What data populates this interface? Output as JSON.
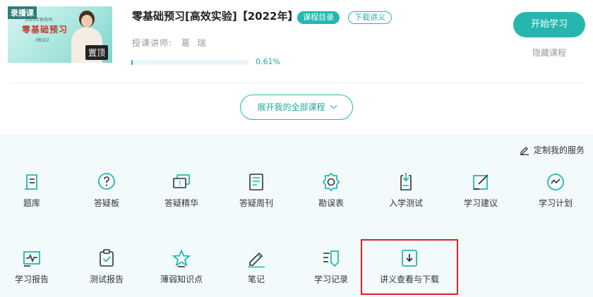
{
  "course": {
    "thumb_tag": "录播课",
    "thumb_year": "2022年税务师",
    "thumb_title": "零基础预习",
    "thumb_sub": "《税法Ⅰ》",
    "pin_label": "置顶",
    "title": "零基础预习[高效实验]【2022年】",
    "badge_catalog": "课程目录",
    "badge_download": "下载讲义",
    "teacher_label": "授课讲师:",
    "teacher_name": "葛  瑞",
    "progress_percent": 0.61,
    "progress_text": "0.61%",
    "start_button": "开始学习",
    "hide_link": "隐藏课程"
  },
  "expand_button": "展开我的全部课程",
  "service": {
    "custom_label": "定制我的服务",
    "tools": [
      {
        "label": "题库",
        "icon": "question-bank-icon"
      },
      {
        "label": "答疑板",
        "icon": "qa-board-icon"
      },
      {
        "label": "答疑精华",
        "icon": "qa-highlights-icon"
      },
      {
        "label": "答疑周刊",
        "icon": "qa-weekly-icon"
      },
      {
        "label": "勘误表",
        "icon": "errata-icon"
      },
      {
        "label": "入学测试",
        "icon": "entrance-test-icon"
      },
      {
        "label": "学习建议",
        "icon": "study-advice-icon"
      },
      {
        "label": "学习计划",
        "icon": "study-plan-icon"
      },
      {
        "label": "学习报告",
        "icon": "study-report-icon"
      },
      {
        "label": "测试报告",
        "icon": "test-report-icon"
      },
      {
        "label": "薄弱知识点",
        "icon": "weak-points-icon"
      },
      {
        "label": "笔记",
        "icon": "notes-icon"
      },
      {
        "label": "学习记录",
        "icon": "study-record-icon"
      },
      {
        "label": "讲义查看与下载",
        "icon": "handout-download-icon"
      }
    ]
  },
  "colors": {
    "accent": "#22b8b0",
    "highlight": "#e02020",
    "panel_bg": "#f3fafc"
  }
}
